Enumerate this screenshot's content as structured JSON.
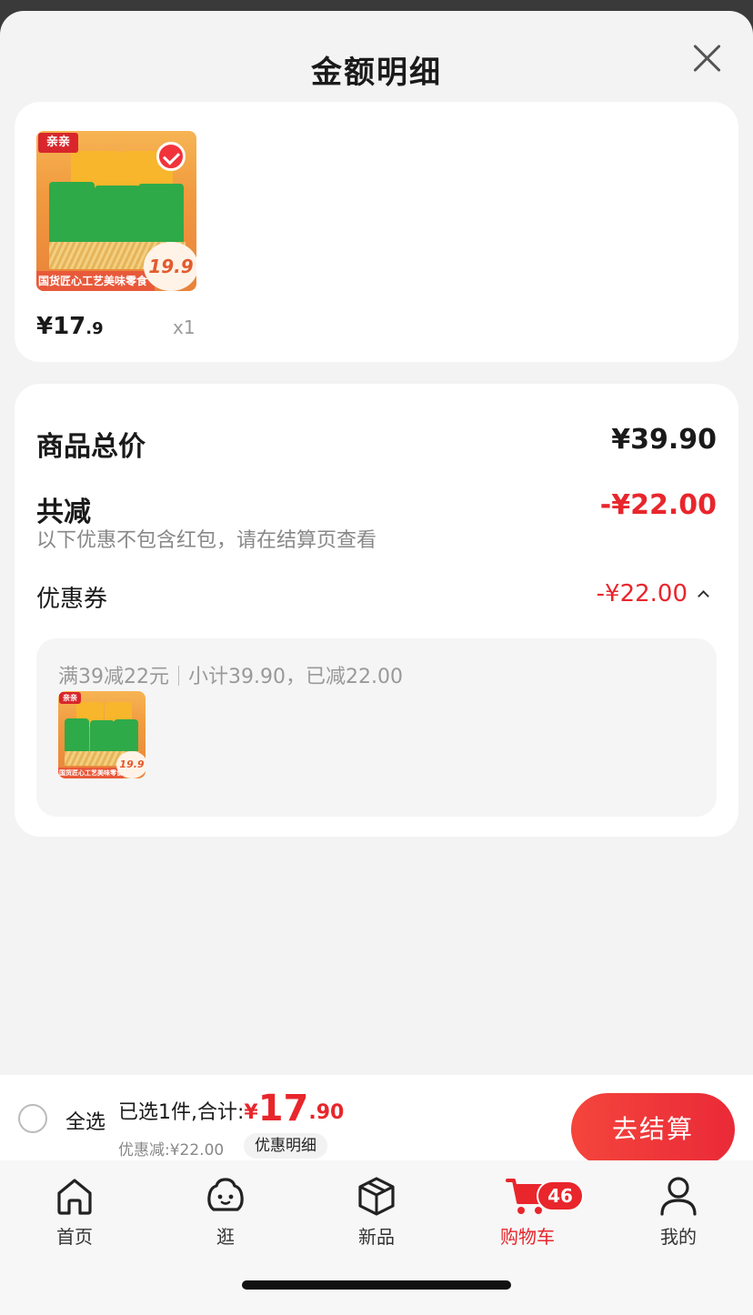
{
  "sheet": {
    "title": "金额明细"
  },
  "product": {
    "thumb_brand": "亲亲",
    "thumb_banner": "国货匠心工艺美味零食",
    "thumb_price": "19.9",
    "price_yen": "¥",
    "price_int": "17",
    "price_dec": ".9",
    "quantity": "x1",
    "selected": true
  },
  "summary": {
    "total_label": "商品总价",
    "total_value": "¥39.90",
    "reduce_label": "共减",
    "reduce_value": "-¥22.00",
    "note": "以下优惠不包含红包，请在结算页查看",
    "coupon_label": "优惠券",
    "coupon_value": "-¥22.00",
    "coupon_rule": "满39减22元",
    "coupon_subtotal": "小计39.90，已减22.00"
  },
  "checkout": {
    "select_all": "全选",
    "selected_text": "已选1件,合计:",
    "total_yen": "¥",
    "total_int": "17",
    "total_dec": ".90",
    "discount_text": "优惠减:¥22.00",
    "discount_detail": "优惠明细",
    "checkout_button": "去结算"
  },
  "tabs": [
    {
      "label": "首页",
      "icon": "home-icon"
    },
    {
      "label": "逛",
      "icon": "browse-face-icon"
    },
    {
      "label": "新品",
      "icon": "box-icon"
    },
    {
      "label": "购物车",
      "icon": "cart-icon",
      "badge": "46",
      "active": true
    },
    {
      "label": "我的",
      "icon": "user-icon"
    }
  ],
  "colors": {
    "accent": "#e8262c",
    "background": "#f3f3f3"
  }
}
